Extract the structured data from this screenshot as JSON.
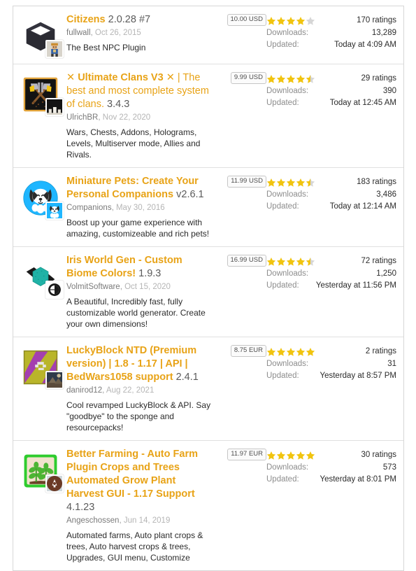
{
  "colors": {
    "title": "#e8a317",
    "star_full": "#f1c40f",
    "star_empty": "#d6d6d6",
    "border": "#d7d7d7",
    "row_divider": "#e0e0e0",
    "muted_text": "#9b9b9b",
    "body_text": "#2b2b2b"
  },
  "labels": {
    "downloads": "Downloads:",
    "updated": "Updated:"
  },
  "resources": [
    {
      "icon_name": "citizens-cube-icon",
      "avatar_name": "author-avatar-fullwall",
      "title_main": "Citizens",
      "title_prefix": "",
      "title_suffix": "",
      "version": "2.0.28 #7",
      "author": "fullwall",
      "date": "Oct 26, 2015",
      "tagline": "The Best NPC Plugin",
      "price": "10.00 USD",
      "stars_full": 4,
      "stars_half": 0,
      "stars_empty": 1,
      "ratings": "170 ratings",
      "downloads": "13,289",
      "updated": "Today at 4:09 AM"
    },
    {
      "icon_name": "ultimate-clans-axes-icon",
      "avatar_name": "author-avatar-ulrichbr",
      "title_main": "Ultimate Clans V3",
      "title_prefix": "✕ ",
      "title_suffix": " ✕ | The best and most complete system of clans.",
      "version": "3.4.3",
      "author": "UlrichBR",
      "date": "Nov 22, 2020",
      "tagline": "Wars, Chests, Addons, Holograms, Levels, Multiserver mode, Allies and Rivals.",
      "price": "9.99 USD",
      "stars_full": 4,
      "stars_half": 1,
      "stars_empty": 0,
      "ratings": "29 ratings",
      "downloads": "390",
      "updated": "Today at 12:45 AM"
    },
    {
      "icon_name": "miniature-pets-dog-icon",
      "avatar_name": "author-avatar-companions",
      "title_main": "Miniature Pets: Create Your Personal Companions",
      "title_prefix": "",
      "title_suffix": "",
      "version": "v2.6.1",
      "author": "Companions",
      "date": "May 30, 2016",
      "tagline": "Boost up your game experience with amazing, customizeable and rich pets!",
      "price": "11.99 USD",
      "stars_full": 4,
      "stars_half": 1,
      "stars_empty": 0,
      "ratings": "183 ratings",
      "downloads": "3,486",
      "updated": "Today at 12:14 AM"
    },
    {
      "icon_name": "iris-world-gen-hexagon-icon",
      "avatar_name": "author-avatar-volmitsoftware",
      "title_main": "Iris World Gen - Custom Biome Colors!",
      "title_prefix": "",
      "title_suffix": "",
      "version": "1.9.3",
      "author": "VolmitSoftware",
      "date": "Oct 15, 2020",
      "tagline": "A Beautiful, Incredibly fast, fully customizable world generator. Create your own dimensions!",
      "price": "16.99 USD",
      "stars_full": 4,
      "stars_half": 1,
      "stars_empty": 0,
      "ratings": "72 ratings",
      "downloads": "1,250",
      "updated": "Yesterday at 11:56 PM"
    },
    {
      "icon_name": "luckyblock-ntd-icon",
      "avatar_name": "author-avatar-danirod12",
      "title_main": "LuckyBlock NTD (Premium version) | 1.8 - 1.17 | API | BedWars1058 support",
      "title_prefix": "",
      "title_suffix": "",
      "version": "2.4.1",
      "author": "danirod12",
      "date": "Aug 22, 2021",
      "tagline": "Cool revamped LuckyBlock & API. Say \"goodbye\" to the sponge and resourcepacks!",
      "price": "8.75 EUR",
      "stars_full": 5,
      "stars_half": 0,
      "stars_empty": 0,
      "ratings": "2 ratings",
      "downloads": "31",
      "updated": "Yesterday at 8:57 PM"
    },
    {
      "icon_name": "better-farming-plants-icon",
      "avatar_name": "author-avatar-angeschossen",
      "title_main": "Better Farming - Auto Farm Plugin Crops and Trees Automated Grow Plant Harvest GUI - 1.17 Support",
      "title_prefix": "",
      "title_suffix": "",
      "version": "4.1.23",
      "author": "Angeschossen",
      "date": "Jun 14, 2019",
      "tagline": "Automated farms, Auto plant crops & trees, Auto harvest crops & trees, Upgrades, GUI menu, Customize",
      "price": "11.97 EUR",
      "stars_full": 5,
      "stars_half": 0,
      "stars_empty": 0,
      "ratings": "30 ratings",
      "downloads": "573",
      "updated": "Yesterday at 8:01 PM"
    }
  ]
}
